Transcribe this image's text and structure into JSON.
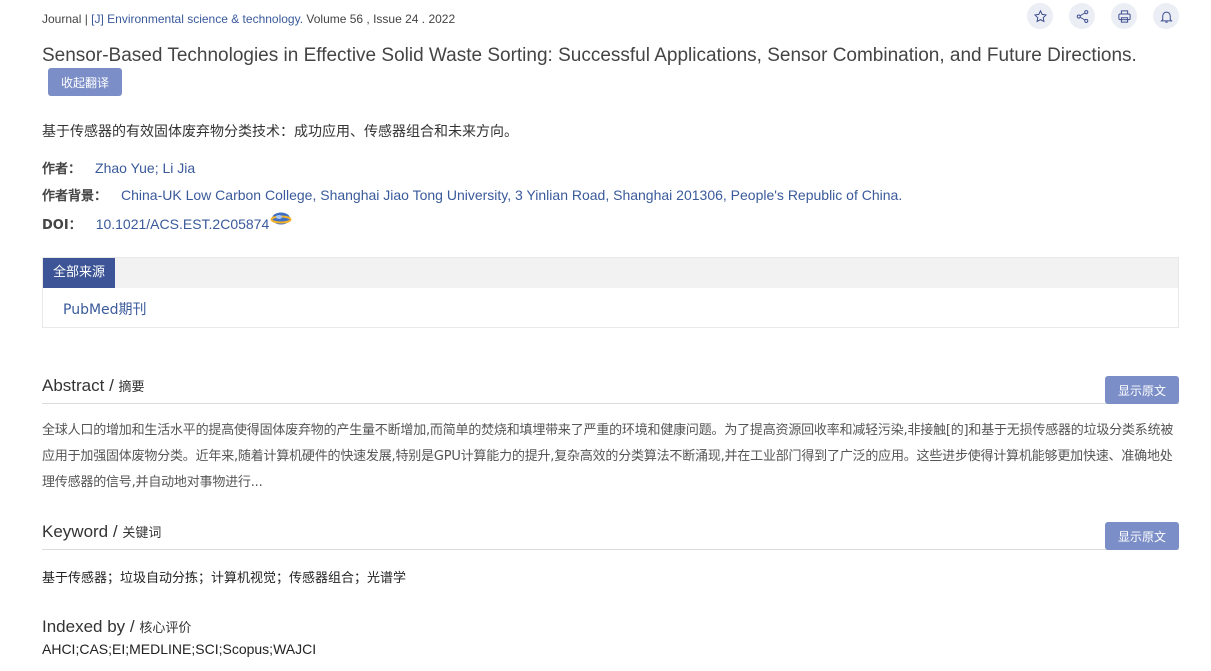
{
  "header": {
    "type": "Journal",
    "sep1": " | ",
    "journal": "[J] Environmental science & technology.",
    "volume": " Volume 56 , Issue 24 . 2022"
  },
  "actions": [
    {
      "name": "favorite",
      "icon": "star-icon"
    },
    {
      "name": "share",
      "icon": "share-icon"
    },
    {
      "name": "print",
      "icon": "printer-icon"
    },
    {
      "name": "alert",
      "icon": "bell-icon"
    }
  ],
  "title": "Sensor-Based Technologies in Effective Solid Waste Sorting: Successful Applications, Sensor Combination, and Future Directions.",
  "collapse_translation_label": "收起翻译",
  "title_translated": "基于传感器的有效固体废弃物分类技术：成功应用、传感器组合和未来方向。",
  "info": {
    "authors_label": "作者：",
    "authors": "Zhao Yue; Li Jia",
    "affiliation_label": "作者背景：",
    "affiliation": "China-UK Low Carbon College, Shanghai Jiao Tong University, 3 Yinlian Road, Shanghai 201306, People's Republic of China.",
    "doi_label": "DOI：",
    "doi": "10.1021/ACS.EST.2C05874"
  },
  "sources": {
    "tab_label": "全部来源",
    "items": [
      "PubMed期刊"
    ]
  },
  "abstract": {
    "heading_en": "Abstract / ",
    "heading_cn": "摘要",
    "show_original_label": "显示原文",
    "text": "全球人口的增加和生活水平的提高使得固体废弃物的产生量不断增加,而简单的焚烧和填埋带来了严重的环境和健康问题。为了提高资源回收率和减轻污染,非接触[的]和基于无损传感器的垃圾分类系统被应用于加强固体废物分类。近年来,随着计算机硬件的快速发展,特别是GPU计算能力的提升,复杂高效的分类算法不断涌现,并在工业部门得到了广泛的应用。这些进步使得计算机能够更加快速、准确地处理传感器的信号,并自动地对事物进行..."
  },
  "keyword": {
    "heading_en": "Keyword / ",
    "heading_cn": "关键词",
    "show_original_label": "显示原文",
    "text": "基于传感器；垃圾自动分拣；计算机视觉；传感器组合；光谱学"
  },
  "indexed": {
    "heading_en": "Indexed by / ",
    "heading_cn": "核心评价",
    "text": "AHCI;CAS;EI;MEDLINE;SCI;Scopus;WAJCI"
  },
  "colors": {
    "accent": "#3d5596",
    "button": "#7b8ec7",
    "link": "#3a5a9b"
  }
}
